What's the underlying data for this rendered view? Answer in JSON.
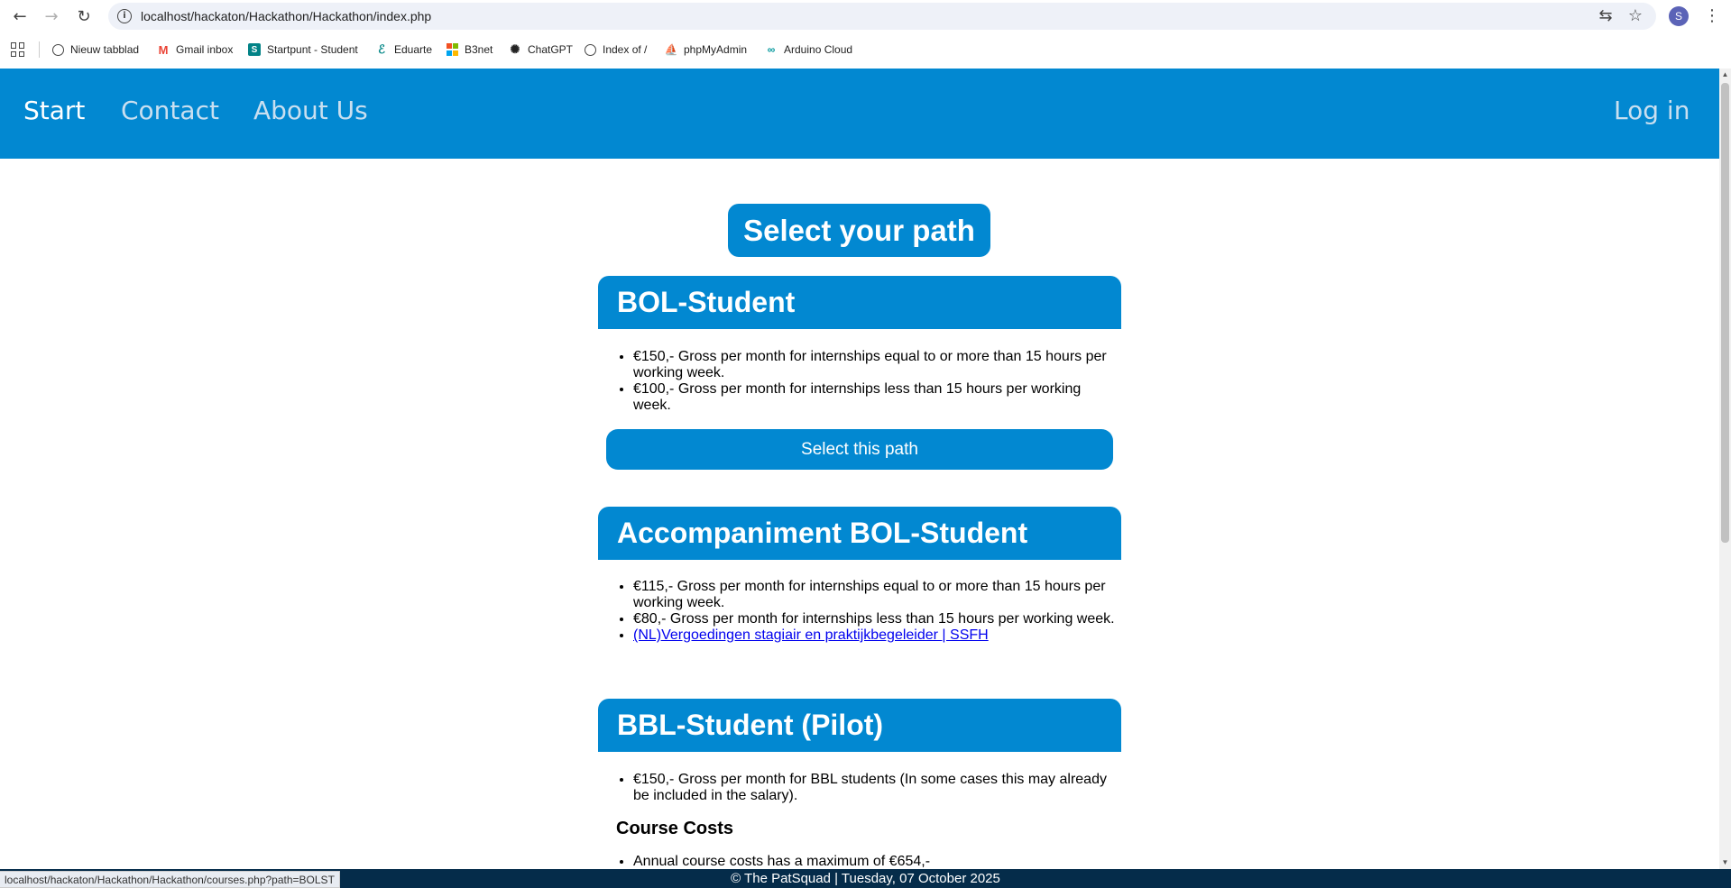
{
  "browser": {
    "url": "localhost/hackaton/Hackathon/Hackathon/index.php",
    "profile_initial": "S",
    "status_url": "localhost/hackaton/Hackathon/Hackathon/courses.php?path=BOLST",
    "bookmarks": [
      {
        "label": "Nieuw tabblad",
        "icon": "globe-icon"
      },
      {
        "label": "Gmail inbox",
        "icon": "gmail-icon"
      },
      {
        "label": "Startpunt - Student",
        "icon": "sharepoint-icon"
      },
      {
        "label": "Eduarte",
        "icon": "eduarte-icon"
      },
      {
        "label": "B3net",
        "icon": "microsoft-icon"
      },
      {
        "label": "ChatGPT",
        "icon": "chatgpt-icon"
      },
      {
        "label": "Index of /",
        "icon": "globe-icon"
      },
      {
        "label": "phpMyAdmin",
        "icon": "phpmyadmin-icon"
      },
      {
        "label": "Arduino Cloud",
        "icon": "arduino-icon"
      }
    ]
  },
  "nav": {
    "start": "Start",
    "contact": "Contact",
    "about": "About Us",
    "login": "Log in"
  },
  "main": {
    "title": "Select your path",
    "cards": [
      {
        "title": "BOL-Student",
        "items": [
          "€150,- Gross per month for internships equal to or more than 15 hours per working week.",
          "€100,- Gross per month for internships less than 15 hours per working week."
        ],
        "button": "Select this path"
      },
      {
        "title": "Accompaniment BOL-Student",
        "items": [
          "€115,- Gross per month for internships equal to or more than 15 hours per working week.",
          "€80,- Gross per month for internships less than 15 hours per working week."
        ],
        "link": "(NL)Vergoedingen stagiair en praktijkbegeleider | SSFH"
      },
      {
        "title": "BBL-Student (Pilot)",
        "items": [
          "€150,- Gross per month for BBL students (In some cases this may already be included in the salary)."
        ],
        "subheading": "Course Costs",
        "sub_items": [
          "Annual course costs has a maximum of €654,-"
        ]
      }
    ]
  },
  "footer": {
    "text": "© The PatSquad | Tuesday, 07 October 2025"
  },
  "colors": {
    "primary": "#0288d1",
    "footer": "#052c4a"
  }
}
